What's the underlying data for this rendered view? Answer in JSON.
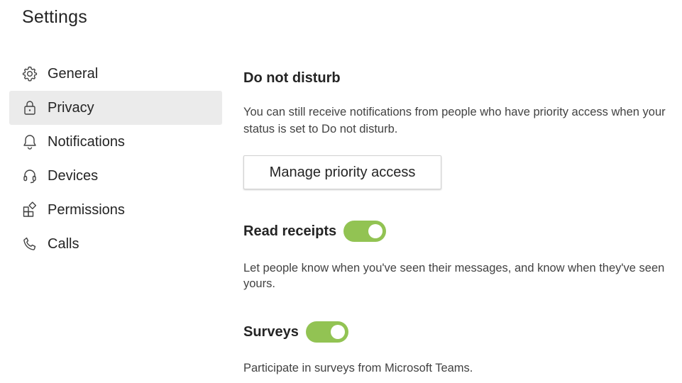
{
  "page": {
    "title": "Settings"
  },
  "sidebar": {
    "items": [
      {
        "label": "General",
        "icon": "gear-icon",
        "active": false
      },
      {
        "label": "Privacy",
        "icon": "lock-icon",
        "active": true
      },
      {
        "label": "Notifications",
        "icon": "bell-icon",
        "active": false
      },
      {
        "label": "Devices",
        "icon": "headset-icon",
        "active": false
      },
      {
        "label": "Permissions",
        "icon": "apps-icon",
        "active": false
      },
      {
        "label": "Calls",
        "icon": "phone-icon",
        "active": false
      }
    ]
  },
  "dnd": {
    "title": "Do not disturb",
    "description": "You can still receive notifications from people who have priority access when your status is set to Do not disturb.",
    "button_label": "Manage priority access"
  },
  "read_receipts": {
    "label": "Read receipts",
    "enabled": true,
    "description": "Let people know when you've seen their messages, and know when they've seen yours."
  },
  "surveys": {
    "label": "Surveys",
    "enabled": true,
    "description": "Participate in surveys from Microsoft Teams."
  },
  "colors": {
    "toggle_on": "#92c353",
    "active_bg": "#ebebeb",
    "text": "#242424"
  }
}
